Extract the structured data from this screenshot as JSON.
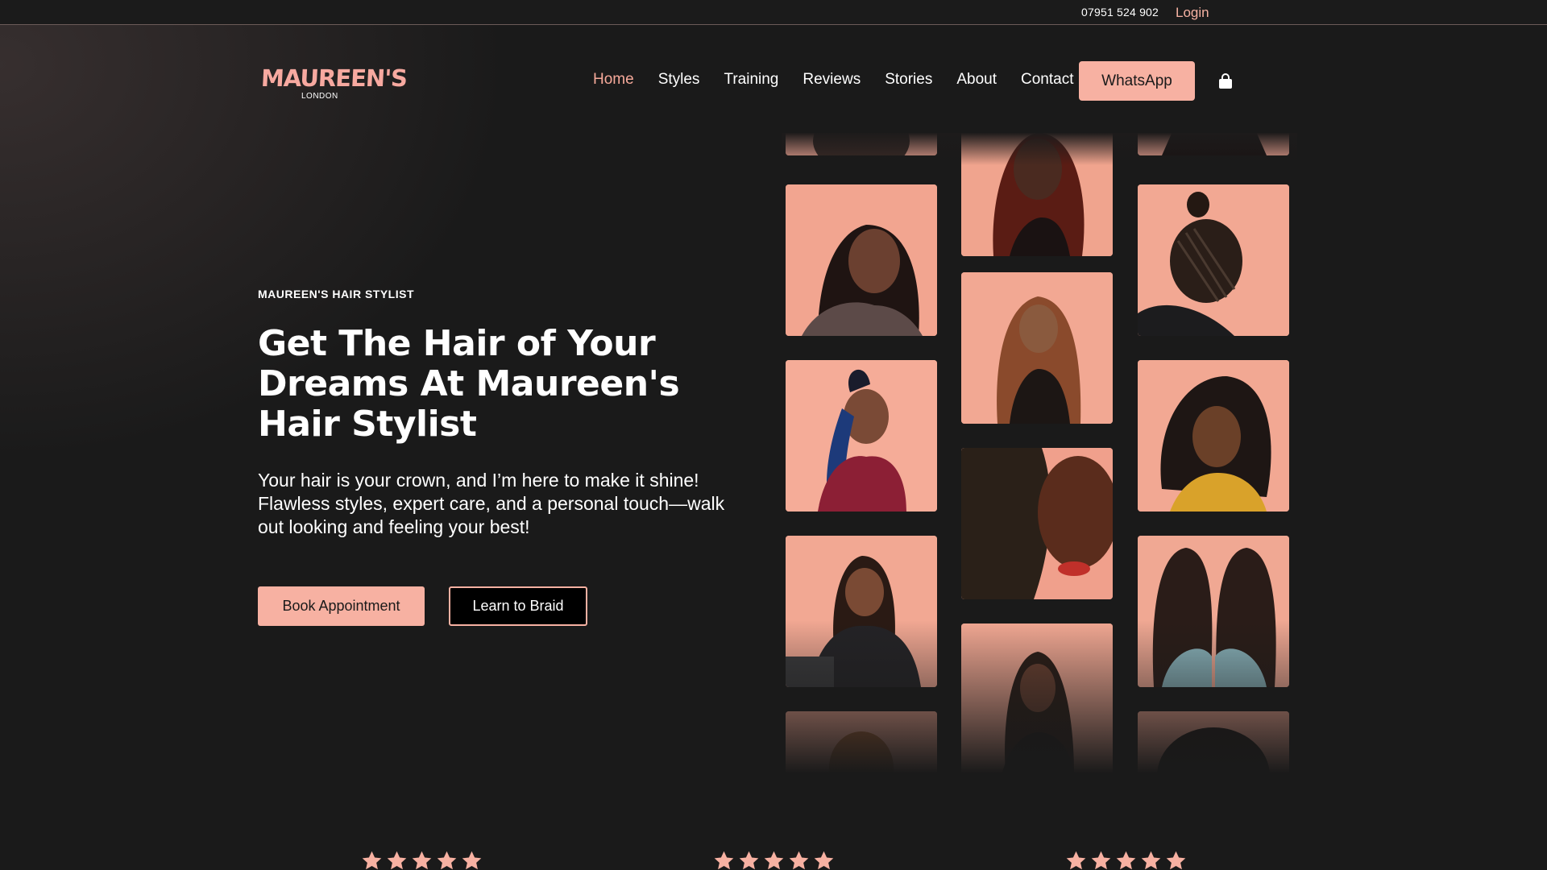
{
  "topbar": {
    "phone": "07951 524 902",
    "login_label": "Login"
  },
  "logo": {
    "brand": "MAUREEN'S",
    "sub": "LONDON"
  },
  "nav": {
    "items": [
      "Home",
      "Styles",
      "Training",
      "Reviews",
      "Stories",
      "About",
      "Contact"
    ],
    "active": "Home",
    "whatsapp_label": "WhatsApp",
    "cart_icon": "shopping-bag-icon"
  },
  "hero": {
    "eyebrow": "MAUREEN'S HAIR STYLIST",
    "title": "Get The Hair of Your Dreams At Maureen's Hair Stylist",
    "text": "Your hair is your crown, and I’m here to make it shine! Flawless styles, expert care, and a personal touch—walk out looking and feeling your best!",
    "book_label": "Book Appointment",
    "learn_label": "Learn to Braid"
  },
  "gallery": {
    "photos": [
      "woman-long-wavy-hair",
      "woman-auburn-curls",
      "woman-braided-updo",
      "woman-bun-glasses-scarf",
      "woman-long-curly-hair",
      "woman-curly-side-hair",
      "woman-seated-glasses",
      "woman-twist-braids",
      "woman-boho-braids-mirrored",
      "woman-bob-hair",
      "woman-long-straight-hair",
      "woman-afro-hair"
    ]
  },
  "reviews": {
    "rating": 5,
    "cards": 3
  },
  "colors": {
    "accent": "#f7b1a2",
    "background": "#1a1a1a",
    "nav_active": "#f6a99a"
  }
}
